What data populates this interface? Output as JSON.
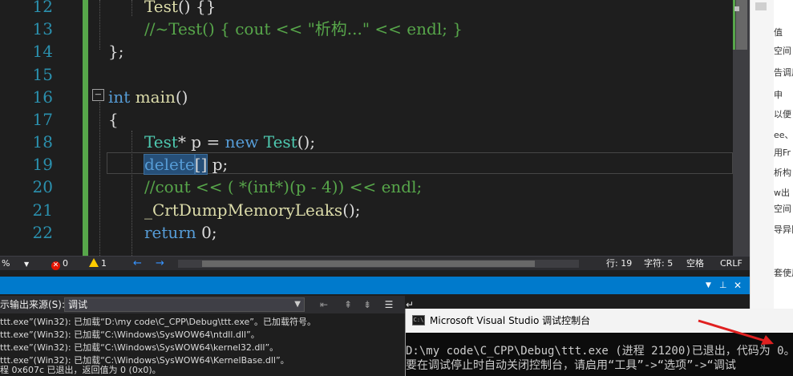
{
  "editor": {
    "line_numbers": [
      "12",
      "13",
      "14",
      "15",
      "16",
      "17",
      "18",
      "19",
      "20",
      "21",
      "22"
    ],
    "lines": {
      "l12": {
        "fn": "Test",
        "rest": "() {}"
      },
      "l13": {
        "comment": "//~Test() { cout << \"析构...\" << endl; }"
      },
      "l14": {
        "text": "};"
      },
      "l16": {
        "kw": "int",
        "fn": "main",
        "rest": "()"
      },
      "l17": {
        "text": "{"
      },
      "l18": {
        "type1": "Test",
        "p1": "* p = ",
        "kw": "new",
        "p2": " ",
        "type2": "Test",
        "p3": "();"
      },
      "l19": {
        "kw": "delete",
        "sel": "[]",
        "rest": " p;"
      },
      "l20": {
        "comment": "//cout << ( *(int*)(p - 4)) << endl;"
      },
      "l21": {
        "fn": "_CrtDumpMemoryLeaks",
        "rest": "();"
      },
      "l22": {
        "kw": "return",
        "rest": " 0;"
      }
    },
    "collapse_glyph": "−"
  },
  "status": {
    "zoom": "%",
    "errors": "0",
    "warnings": "1",
    "line": "行: 19",
    "char": "字符: 5",
    "spaces": "空格",
    "eol": "CRLF"
  },
  "output": {
    "source_label": "示输出来源(S):",
    "source_value": "调试",
    "lines": [
      "ttt.exe”(Win32): 已加载“D:\\my code\\C_CPP\\Debug\\ttt.exe”。已加载符号。",
      "ttt.exe”(Win32): 已加载“C:\\Windows\\SysWOW64\\ntdll.dll”。",
      "ttt.exe”(Win32): 已加载“C:\\Windows\\SysWOW64\\kernel32.dll”。",
      "ttt.exe”(Win32): 已加载“C:\\Windows\\SysWOW64\\KernelBase.dll”。",
      "程 0x607c 已退出，返回值为 0 (0x0)。"
    ]
  },
  "console": {
    "title": "Microsoft Visual Studio 调试控制台",
    "icon_text": "C:\\",
    "lines": [
      "D:\\my code\\C_CPP\\Debug\\ttt.exe (进程 21200)已退出，代码为 0。",
      "要在调试停止时自动关闭控制台，请启用“工具”->“选项”->“调试"
    ]
  },
  "browser_strip": {
    "items": [
      "值",
      "空间",
      "告调用",
      "申",
      "以便",
      "ee、",
      "用Fr",
      "析构",
      "w出",
      "空间",
      "导异同",
      "套使用"
    ]
  },
  "colors": {
    "line_number": "#2b91af",
    "keyword": "#569cd6",
    "type": "#4ec9b0",
    "comment": "#57a64a",
    "function": "#dcdcaa",
    "accent": "#007acc",
    "arrow": "#e02020"
  }
}
